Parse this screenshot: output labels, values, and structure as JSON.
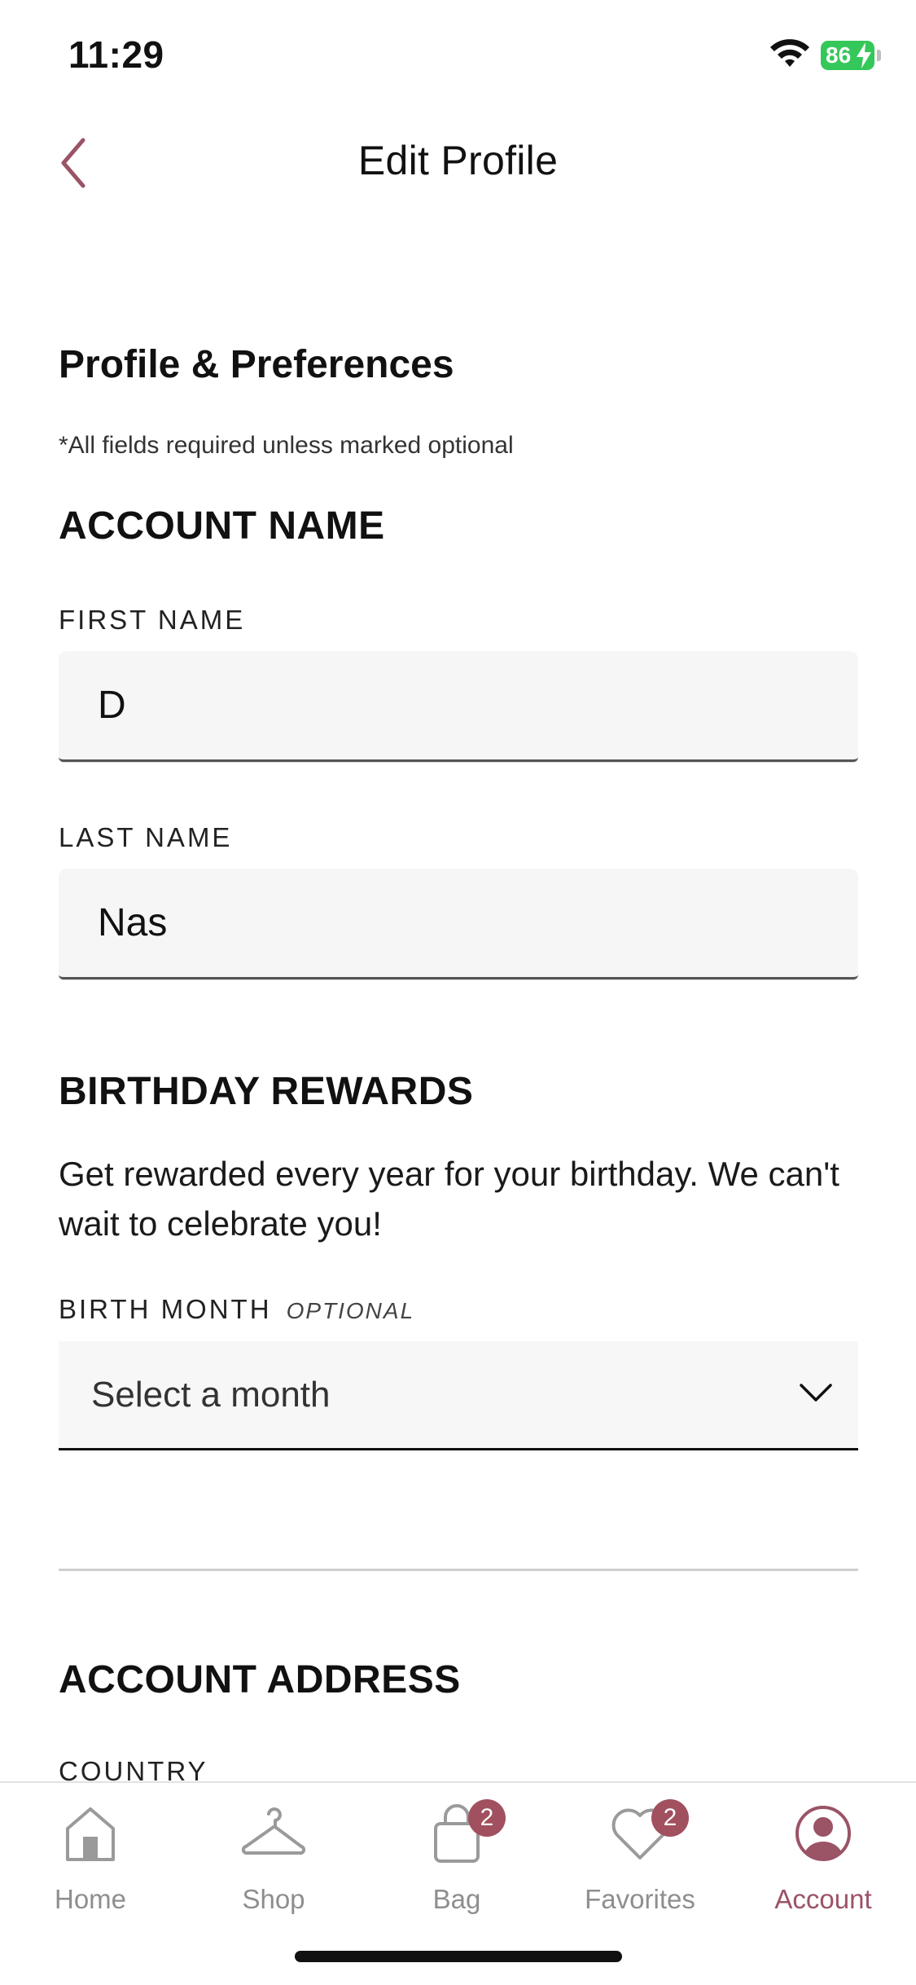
{
  "status_bar": {
    "time": "11:29",
    "battery": "86"
  },
  "header": {
    "title": "Edit Profile"
  },
  "profile": {
    "section_title": "Profile & Preferences",
    "required_note": "*All fields required unless marked optional"
  },
  "account_name": {
    "title": "ACCOUNT NAME",
    "first_name_label": "FIRST NAME",
    "first_name_value": "D",
    "last_name_label": "LAST NAME",
    "last_name_value": "Nas"
  },
  "birthday": {
    "title": "BIRTHDAY REWARDS",
    "description": "Get rewarded every year for your birthday. We can't wait to celebrate you!",
    "month_label": "BIRTH MONTH",
    "optional_tag": "OPTIONAL",
    "month_selected": "Select a month"
  },
  "address": {
    "title": "ACCOUNT ADDRESS",
    "country_label": "COUNTRY"
  },
  "tabs": [
    {
      "label": "Home",
      "icon": "home-icon"
    },
    {
      "label": "Shop",
      "icon": "hanger-icon"
    },
    {
      "label": "Bag",
      "icon": "bag-icon",
      "badge": "2"
    },
    {
      "label": "Favorites",
      "icon": "heart-icon",
      "badge": "2"
    },
    {
      "label": "Account",
      "icon": "account-icon",
      "active": true
    }
  ],
  "colors": {
    "accent": "#9b5366",
    "badge": "#a0505e",
    "battery": "#34c759"
  }
}
